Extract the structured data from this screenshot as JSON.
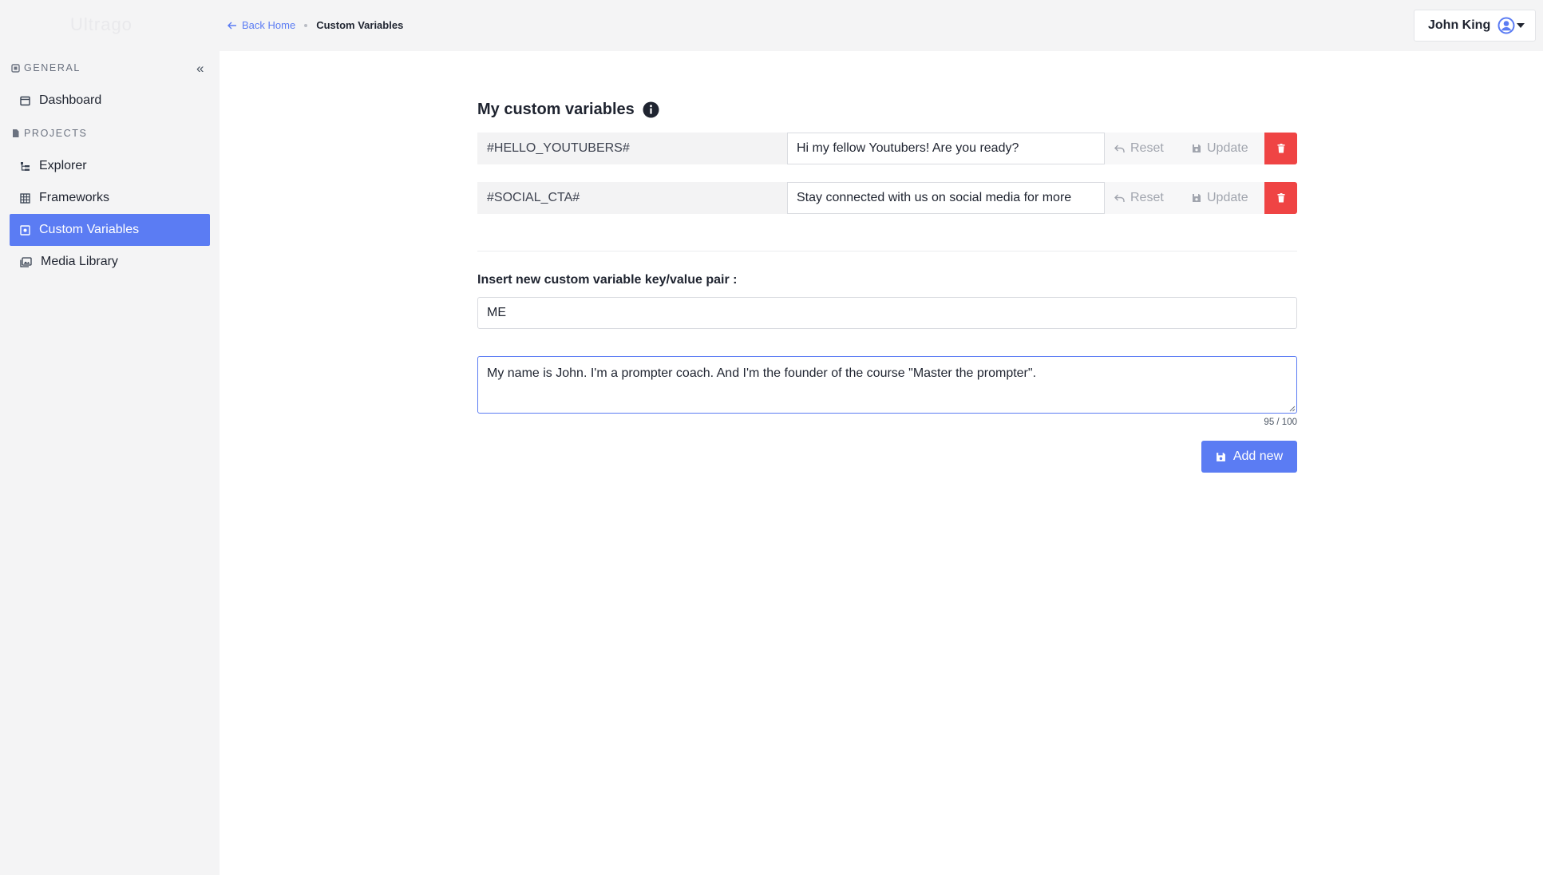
{
  "app": {
    "logo": "Ultrago"
  },
  "sidebar": {
    "general_heading": "GENERAL",
    "projects_heading": "PROJECTS",
    "items": [
      {
        "label": "Dashboard"
      },
      {
        "label": "Explorer"
      },
      {
        "label": "Frameworks"
      },
      {
        "label": "Custom Variables"
      },
      {
        "label": "Media Library"
      }
    ]
  },
  "breadcrumb": {
    "back": "Back Home",
    "current": "Custom Variables"
  },
  "user": {
    "name": "John King"
  },
  "main": {
    "title": "My custom variables",
    "variables": [
      {
        "key": "#HELLO_YOUTUBERS#",
        "value": "Hi my fellow Youtubers! Are you ready?"
      },
      {
        "key": "#SOCIAL_CTA#",
        "value": "Stay connected with us on social media for more"
      }
    ],
    "reset_label": "Reset",
    "update_label": "Update",
    "insert_label": "Insert new custom variable key/value pair :",
    "new_key": "ME",
    "new_value": "My name is John. I'm a prompter coach. And I'm the founder of the course \"Master the prompter\".",
    "counter": "95 / 100",
    "add_label": "Add new"
  },
  "colors": {
    "accent": "#5b7cf3",
    "danger": "#ef4444"
  }
}
